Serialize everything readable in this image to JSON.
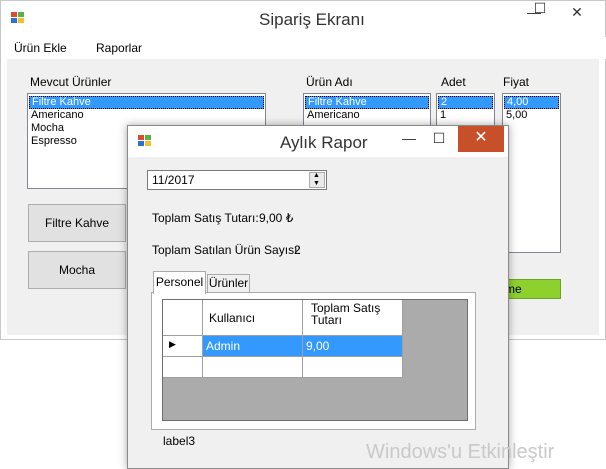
{
  "main_window": {
    "title": "Sipariş Ekranı",
    "menu": [
      "Ürün Ekle",
      "Raporlar"
    ],
    "controls": {
      "minimize": "—",
      "maximize": "☐",
      "close": "✕"
    },
    "mevcut_label": "Mevcut Ürünler",
    "mevcut_items": [
      "Filtre Kahve",
      "Americano",
      "Mocha",
      "Espresso"
    ],
    "urun_adi_label": "Ürün Adı",
    "urun_adi_items": [
      "Filtre Kahve",
      "Americano"
    ],
    "adet_label": "Adet",
    "adet_items": [
      "2",
      "1"
    ],
    "fiyat_label": "Fiyat",
    "fiyat_items": [
      "4,00",
      "5,00"
    ],
    "buttons": [
      "Filtre Kahve",
      "Mocha"
    ],
    "green_button_text": "me"
  },
  "report_window": {
    "title": "Aylık Rapor",
    "controls": {
      "minimize": "—",
      "maximize": "☐",
      "close": "✕"
    },
    "date_value": "11/2017",
    "total_sales_label": "Toplam Satış Tutarı:",
    "total_sales_value": "9,00 ₺",
    "total_count_label": "Toplam Satılan Ürün Sayısı:",
    "total_count_value": "2",
    "tabs": [
      "Personel",
      "Ürünler"
    ],
    "grid": {
      "headers": [
        "Kullanıcı",
        "Toplam Satış Tutarı"
      ],
      "rows": [
        [
          "Admin",
          "9,00"
        ],
        [
          "",
          ""
        ]
      ]
    },
    "footer_label": "label3"
  },
  "watermark": "Windows'u Etkinleştir",
  "colors": {
    "selection": "#3399ff",
    "close_red": "#c7502a",
    "green_button": "#8ed02e",
    "grid_bg": "#ababab"
  }
}
